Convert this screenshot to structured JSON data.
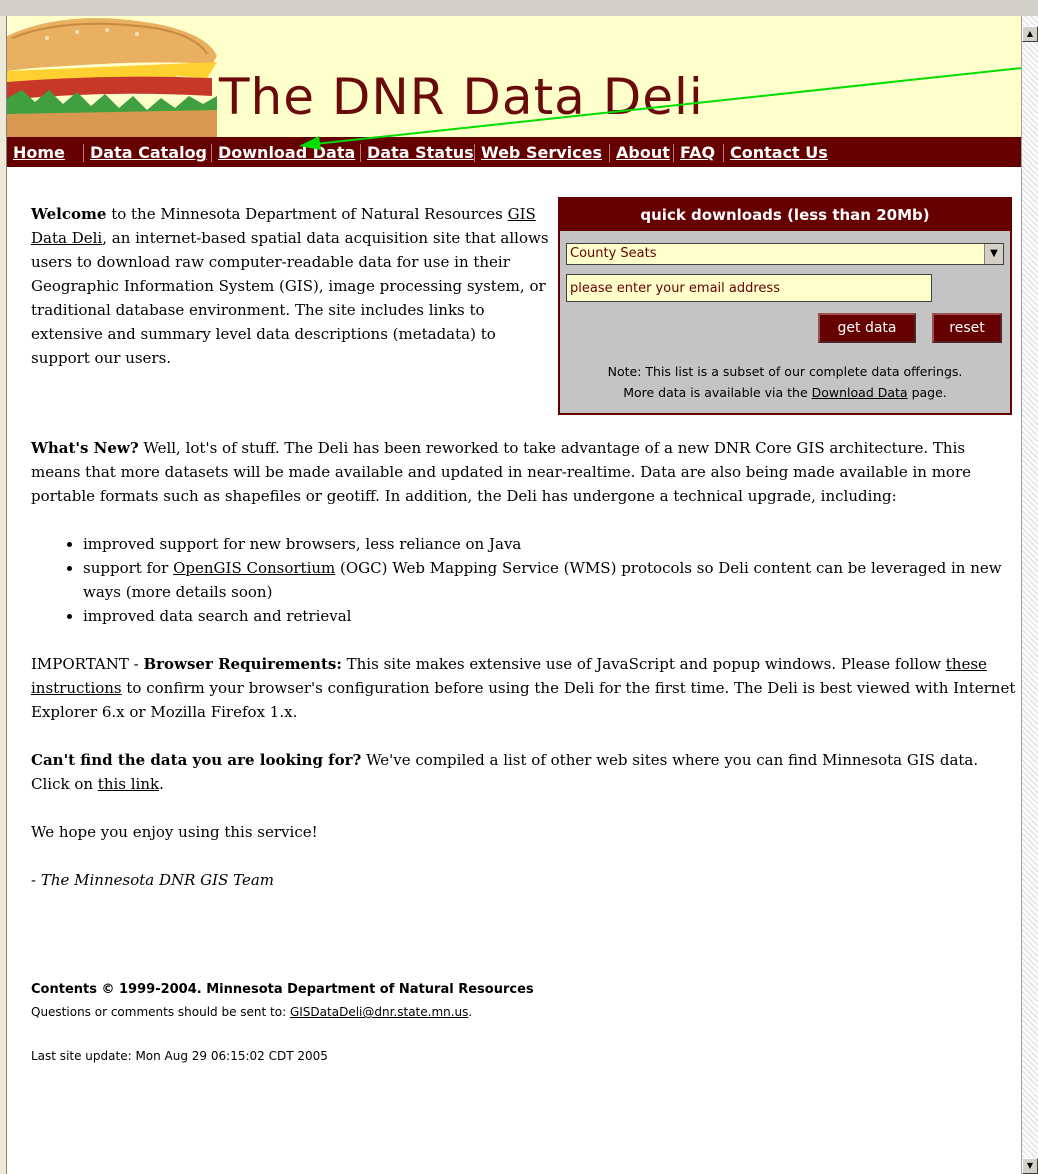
{
  "header": {
    "site_title": "The DNR Data Deli"
  },
  "nav": {
    "items": [
      "Home",
      "Data Catalog",
      "Download Data",
      "Data Status",
      "Web Services",
      "About",
      "FAQ",
      "Contact Us"
    ]
  },
  "quick_downloads": {
    "title": "quick downloads (less than 20Mb)",
    "selected": "County Seats",
    "email_placeholder": "please enter your email address",
    "get_data_label": "get data",
    "reset_label": "reset",
    "note_line1": "Note: This list is a subset of our complete data offerings.",
    "note_line2_before": "More data is available via the ",
    "note_link": "Download Data",
    "note_line2_after": " page."
  },
  "welcome": {
    "bold": "Welcome",
    "text1": " to the Minnesota Department of Natural Resources ",
    "link": "GIS Data Deli",
    "text2": ", an internet-based spatial data acquisition site that allows users to download raw computer-readable data for use in their Geographic Information System (GIS), image processing system, or traditional database environment. The site includes links to extensive and summary level data descriptions (metadata) to support our users."
  },
  "whats_new": {
    "bold": "What's New?",
    "text": " Well, lot's of stuff. The Deli has been reworked to take advantage of a new DNR Core GIS architecture. This means that more datasets will be made available and updated in near-realtime. Data are also being made available in more portable formats such as shapefiles or geotiff. In addition, the Deli has undergone a technical upgrade, including:",
    "bullet1": "improved support for new browsers, less reliance on Java",
    "bullet2_before": "support for ",
    "bullet2_link": "OpenGIS Consortium",
    "bullet2_after": " (OGC) Web Mapping Service (WMS) protocols so Deli content can be leveraged in new ways (more details soon)",
    "bullet3": "improved data search and retrieval"
  },
  "important": {
    "bold_plain": "IMPORTANT",
    "dash": " - ",
    "bold_strong": "Browser Requirements:",
    "text1": " This site makes extensive use of JavaScript and popup windows. Please follow ",
    "link": "these instructions",
    "text2": " to confirm your browser's configuration before using the Deli for the first time. The Deli is best viewed with Internet Explorer 6.x or Mozilla Firefox 1.x."
  },
  "cant_find": {
    "bold": "Can't find the data you are looking for?",
    "text1": " We've compiled a list of other web sites where you can find Minnesota GIS data. Click on ",
    "link": "this link",
    "text2": "."
  },
  "closing": "We hope you enjoy using this service!",
  "signature": "- The Minnesota DNR GIS Team",
  "footer": {
    "copyright": "Contents © 1999-2004. Minnesota Department of Natural Resources",
    "contact_text": "Questions or comments should be sent to: ",
    "contact_email": "GISDataDeli@dnr.state.mn.us",
    "contact_end": ".",
    "last_update": "Last site update: Mon Aug 29 06:15:02 CDT 2005"
  },
  "colors": {
    "brand": "#660000",
    "banner_bg": "#ffffcc",
    "annotation_arrow": "#00dd00"
  }
}
